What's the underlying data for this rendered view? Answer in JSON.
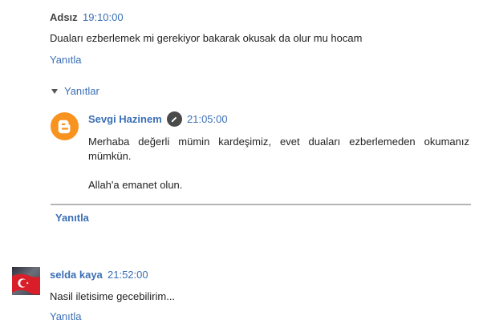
{
  "comment1": {
    "author": "Adsız",
    "time": "19:10:00",
    "text": "Duaları ezberlemek mi gerekiyor bakarak okusak da olur mu hocam",
    "reply_label": "Yanıtla"
  },
  "replies_toggle": {
    "label": "Yanıtlar"
  },
  "reply1": {
    "author": "Sevgi Hazinem",
    "time": "21:05:00",
    "paragraph1": "Merhaba değerli mümin kardeşimiz, evet duaları ezberlemeden okumanız mümkün.",
    "paragraph2": "Allah'a emanet olun.",
    "avatar_icon": "blogger-icon",
    "edit_icon": "pencil-icon",
    "reply_label": "Yanıtla"
  },
  "comment2": {
    "author": "selda kaya",
    "time": "21:52:00",
    "text": "Nasil iletisime gecebilirim...",
    "avatar_icon": "turkish-flag-avatar",
    "reply_label": "Yanıtla"
  },
  "colors": {
    "link": "#3b6fb6",
    "blogger_orange": "#f7931e",
    "flag_red": "#d81e28"
  }
}
